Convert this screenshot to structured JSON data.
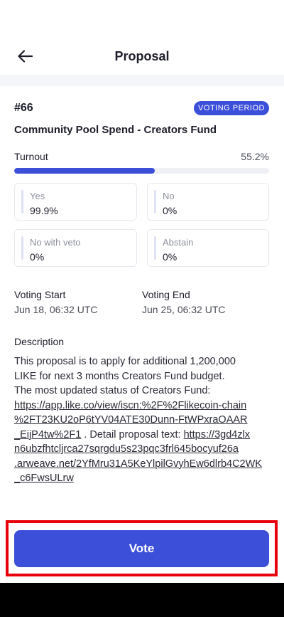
{
  "header": {
    "title": "Proposal"
  },
  "icons": {
    "back": "back-arrow-icon"
  },
  "colors": {
    "accent": "#3c4fd9",
    "highlight": "#e8000b",
    "text": "#1d1e2b",
    "muted": "#8d909c",
    "body": "#2a2b36"
  },
  "proposal": {
    "id_label": "#66",
    "status_badge": "VOTING PERIOD",
    "title": "Community Pool Spend - Creators Fund"
  },
  "turnout": {
    "label": "Turnout",
    "value_text": "55.2%",
    "fill_percent": 55.2
  },
  "tally": [
    {
      "label": "Yes",
      "value": "99.9%"
    },
    {
      "label": "No",
      "value": "0%"
    },
    {
      "label": "No with veto",
      "value": "0%"
    },
    {
      "label": "Abstain",
      "value": "0%"
    }
  ],
  "voting_start": {
    "label": "Voting Start",
    "value": "Jun 18, 06:32 UTC"
  },
  "voting_end": {
    "label": "Voting End",
    "value": "Jun 25, 06:32 UTC"
  },
  "description": {
    "label": "Description",
    "lines": [
      [
        {
          "text": "This proposal is to apply for additional 1,200,000",
          "link": false
        }
      ],
      [
        {
          "text": "LIKE for next 3 months Creators Fund budget.",
          "link": false
        }
      ],
      [
        {
          "text": "The most updated status of Creators Fund:",
          "link": false
        }
      ],
      [
        {
          "text": "https://app.like.co/view/iscn:%2F%2Flikecoin-chain",
          "link": true
        }
      ],
      [
        {
          "text": "%2FT23KU2oP6tYV04ATE30Dunn-FtWPxraOAAR",
          "link": true
        }
      ],
      [
        {
          "text": "_EijP4tw%2F1",
          "link": true
        },
        {
          "text": " . Detail proposal text: ",
          "link": false
        },
        {
          "text": "https://3gd4zlx",
          "link": true
        }
      ],
      [
        {
          "text": "n6ubzfhtcljrca27sqrgdu5s23pqc3frl645bocyuf26a",
          "link": true
        }
      ],
      [
        {
          "text": ".arweave.net/2YfMru31A5KeYlpilGvyhEw6dlrb4C2WK",
          "link": true
        }
      ],
      [
        {
          "text": "_c6FwsULrw",
          "link": true
        }
      ]
    ]
  },
  "vote_button": {
    "label": "Vote"
  }
}
